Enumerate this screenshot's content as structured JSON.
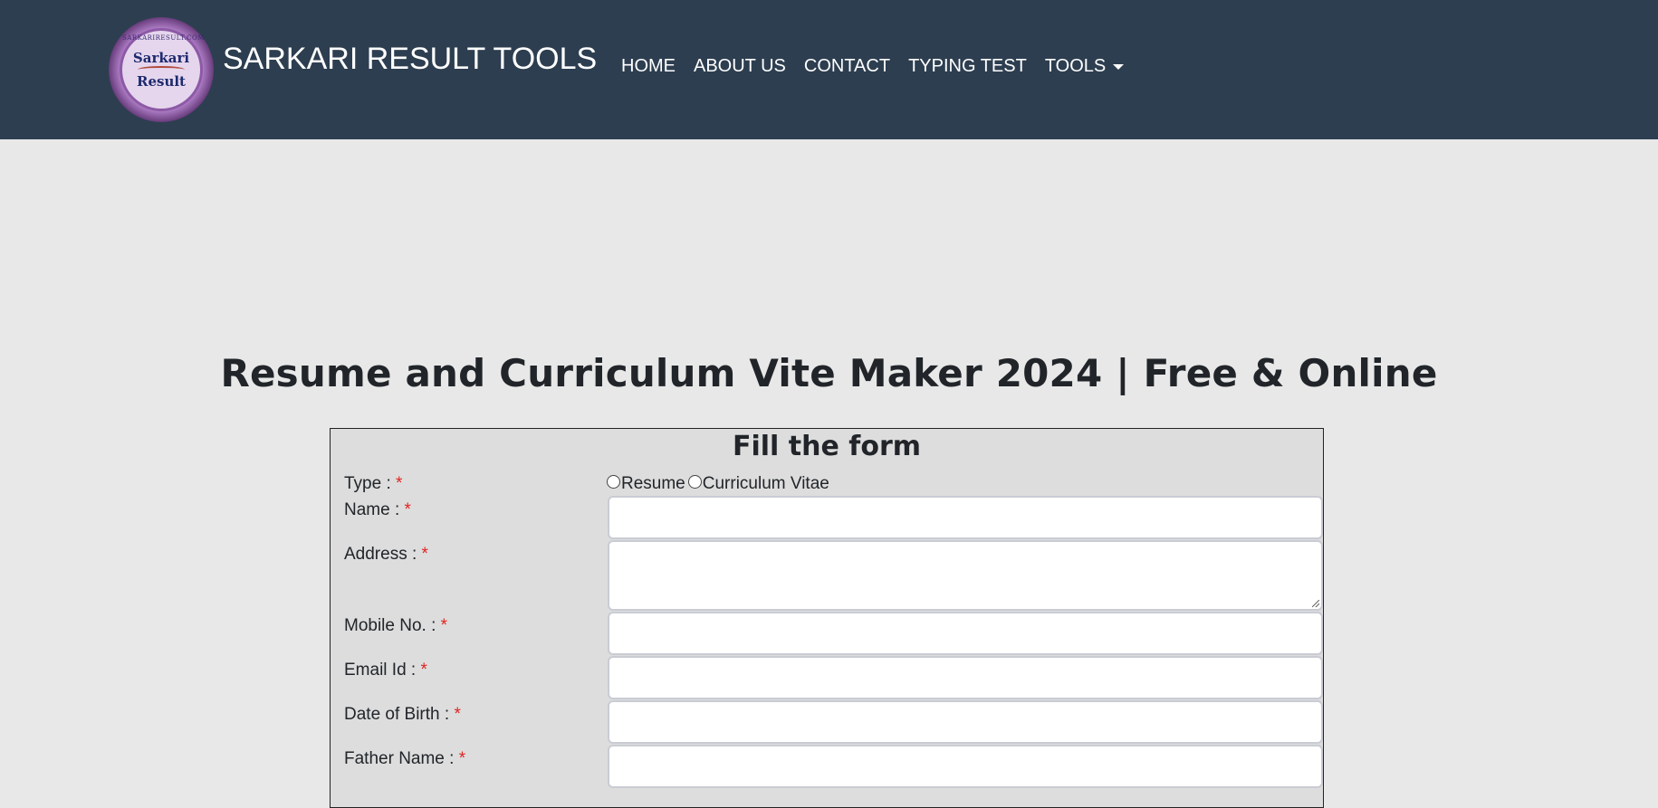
{
  "header": {
    "brand": "SARKARI RESULT TOOLS",
    "logo": {
      "top_word": "Sarkari",
      "bottom_word": "Result",
      "ring_text": "SARKARIRESULT.COM"
    },
    "nav": [
      {
        "label": "HOME"
      },
      {
        "label": "ABOUT US"
      },
      {
        "label": "CONTACT"
      },
      {
        "label": "TYPING TEST"
      },
      {
        "label": "TOOLS"
      }
    ]
  },
  "page": {
    "title": "Resume and Curriculum Vite Maker 2024 | Free & Online"
  },
  "form": {
    "heading": "Fill the form",
    "type_label": "Type : ",
    "type_options": [
      "Resume",
      "Curriculum Vitae"
    ],
    "name_label": "Name : ",
    "name_value": "",
    "address_label": "Address : ",
    "address_value": "",
    "mobile_label": "Mobile No. : ",
    "mobile_value": "",
    "email_label": "Email Id : ",
    "email_value": "",
    "dob_label": "Date of Birth : ",
    "dob_value": "",
    "father_label": "Father Name : ",
    "father_value": "",
    "required_mark": "*"
  }
}
